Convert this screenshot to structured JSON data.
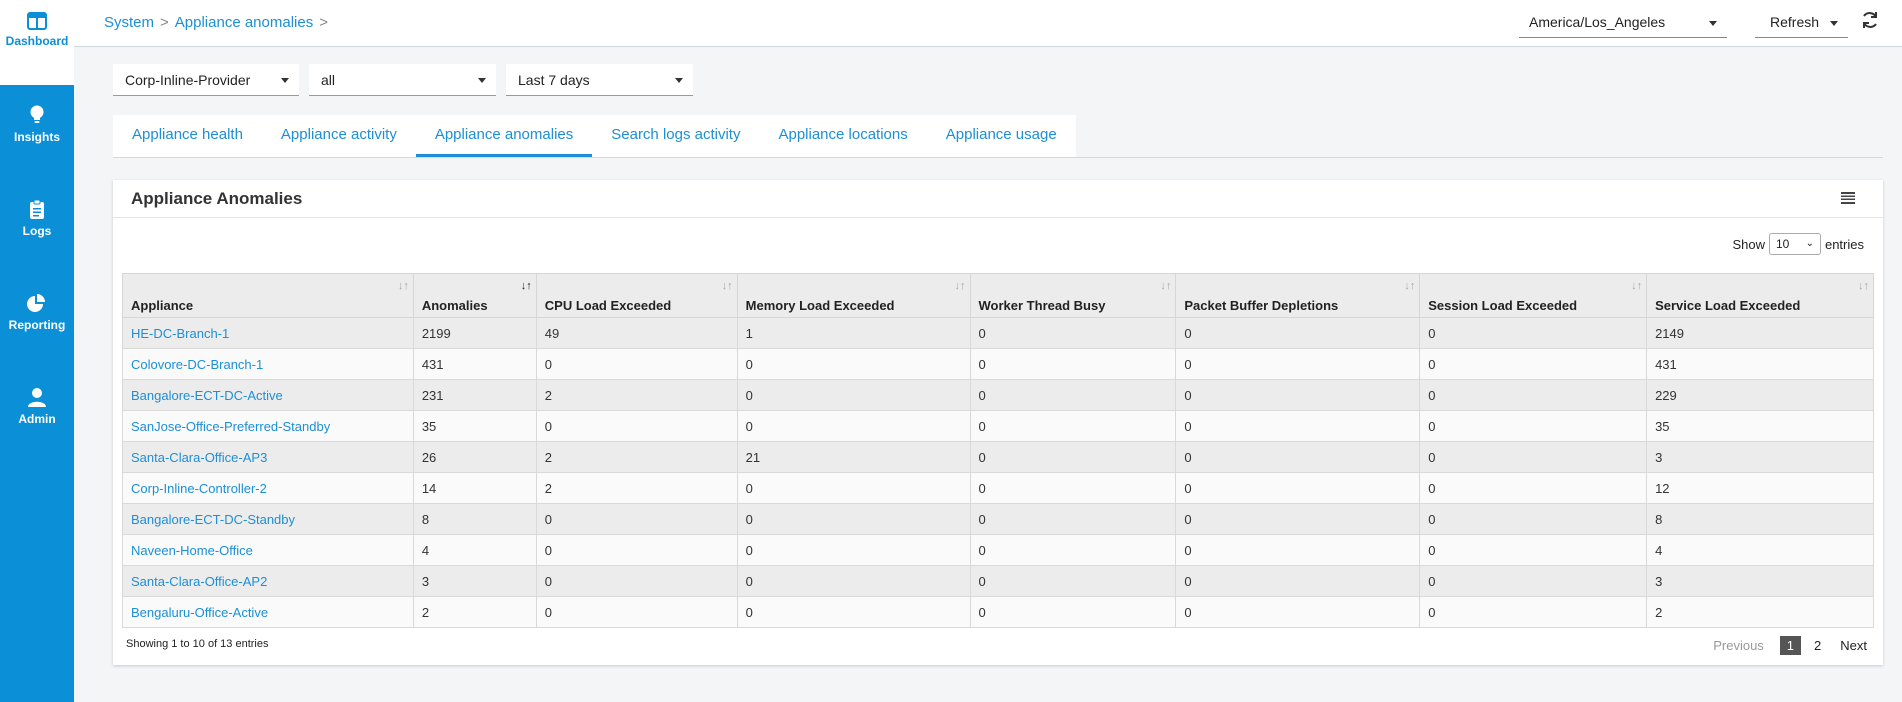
{
  "sidebar": {
    "items": [
      {
        "label": "Dashboard",
        "icon": "dashboard-icon"
      },
      {
        "label": "Insights",
        "icon": "lightbulb-icon"
      },
      {
        "label": "Logs",
        "icon": "clipboard-icon"
      },
      {
        "label": "Reporting",
        "icon": "pie-chart-icon"
      },
      {
        "label": "Admin",
        "icon": "user-icon"
      }
    ]
  },
  "header": {
    "breadcrumb": [
      "System",
      "Appliance anomalies"
    ],
    "separator": ">",
    "timezone": "America/Los_Angeles",
    "refresh_label": "Refresh"
  },
  "filters": {
    "provider": "Corp-Inline-Provider",
    "scope": "all",
    "range": "Last 7 days"
  },
  "tabs": [
    {
      "label": "Appliance health"
    },
    {
      "label": "Appliance activity"
    },
    {
      "label": "Appliance anomalies",
      "active": true
    },
    {
      "label": "Search logs activity"
    },
    {
      "label": "Appliance locations"
    },
    {
      "label": "Appliance usage"
    }
  ],
  "panel": {
    "title": "Appliance Anomalies",
    "show_prefix": "Show",
    "show_value": "10",
    "show_suffix": "entries"
  },
  "table": {
    "columns": [
      "Appliance",
      "Anomalies",
      "CPU Load Exceeded",
      "Memory Load Exceeded",
      "Worker Thread Busy",
      "Packet Buffer Depletions",
      "Session Load Exceeded",
      "Service Load Exceeded"
    ],
    "rows": [
      [
        "HE-DC-Branch-1",
        "2199",
        "49",
        "1",
        "0",
        "0",
        "0",
        "2149"
      ],
      [
        "Colovore-DC-Branch-1",
        "431",
        "0",
        "0",
        "0",
        "0",
        "0",
        "431"
      ],
      [
        "Bangalore-ECT-DC-Active",
        "231",
        "2",
        "0",
        "0",
        "0",
        "0",
        "229"
      ],
      [
        "SanJose-Office-Preferred-Standby",
        "35",
        "0",
        "0",
        "0",
        "0",
        "0",
        "35"
      ],
      [
        "Santa-Clara-Office-AP3",
        "26",
        "2",
        "21",
        "0",
        "0",
        "0",
        "3"
      ],
      [
        "Corp-Inline-Controller-2",
        "14",
        "2",
        "0",
        "0",
        "0",
        "0",
        "12"
      ],
      [
        "Bangalore-ECT-DC-Standby",
        "8",
        "0",
        "0",
        "0",
        "0",
        "0",
        "8"
      ],
      [
        "Naveen-Home-Office",
        "4",
        "0",
        "0",
        "0",
        "0",
        "0",
        "4"
      ],
      [
        "Santa-Clara-Office-AP2",
        "3",
        "0",
        "0",
        "0",
        "0",
        "0",
        "3"
      ],
      [
        "Bengaluru-Office-Active",
        "2",
        "0",
        "0",
        "0",
        "0",
        "0",
        "2"
      ]
    ]
  },
  "footer": {
    "info": "Showing 1 to 10 of 13 entries",
    "prev": "Previous",
    "pages": [
      "1",
      "2"
    ],
    "next": "Next"
  }
}
